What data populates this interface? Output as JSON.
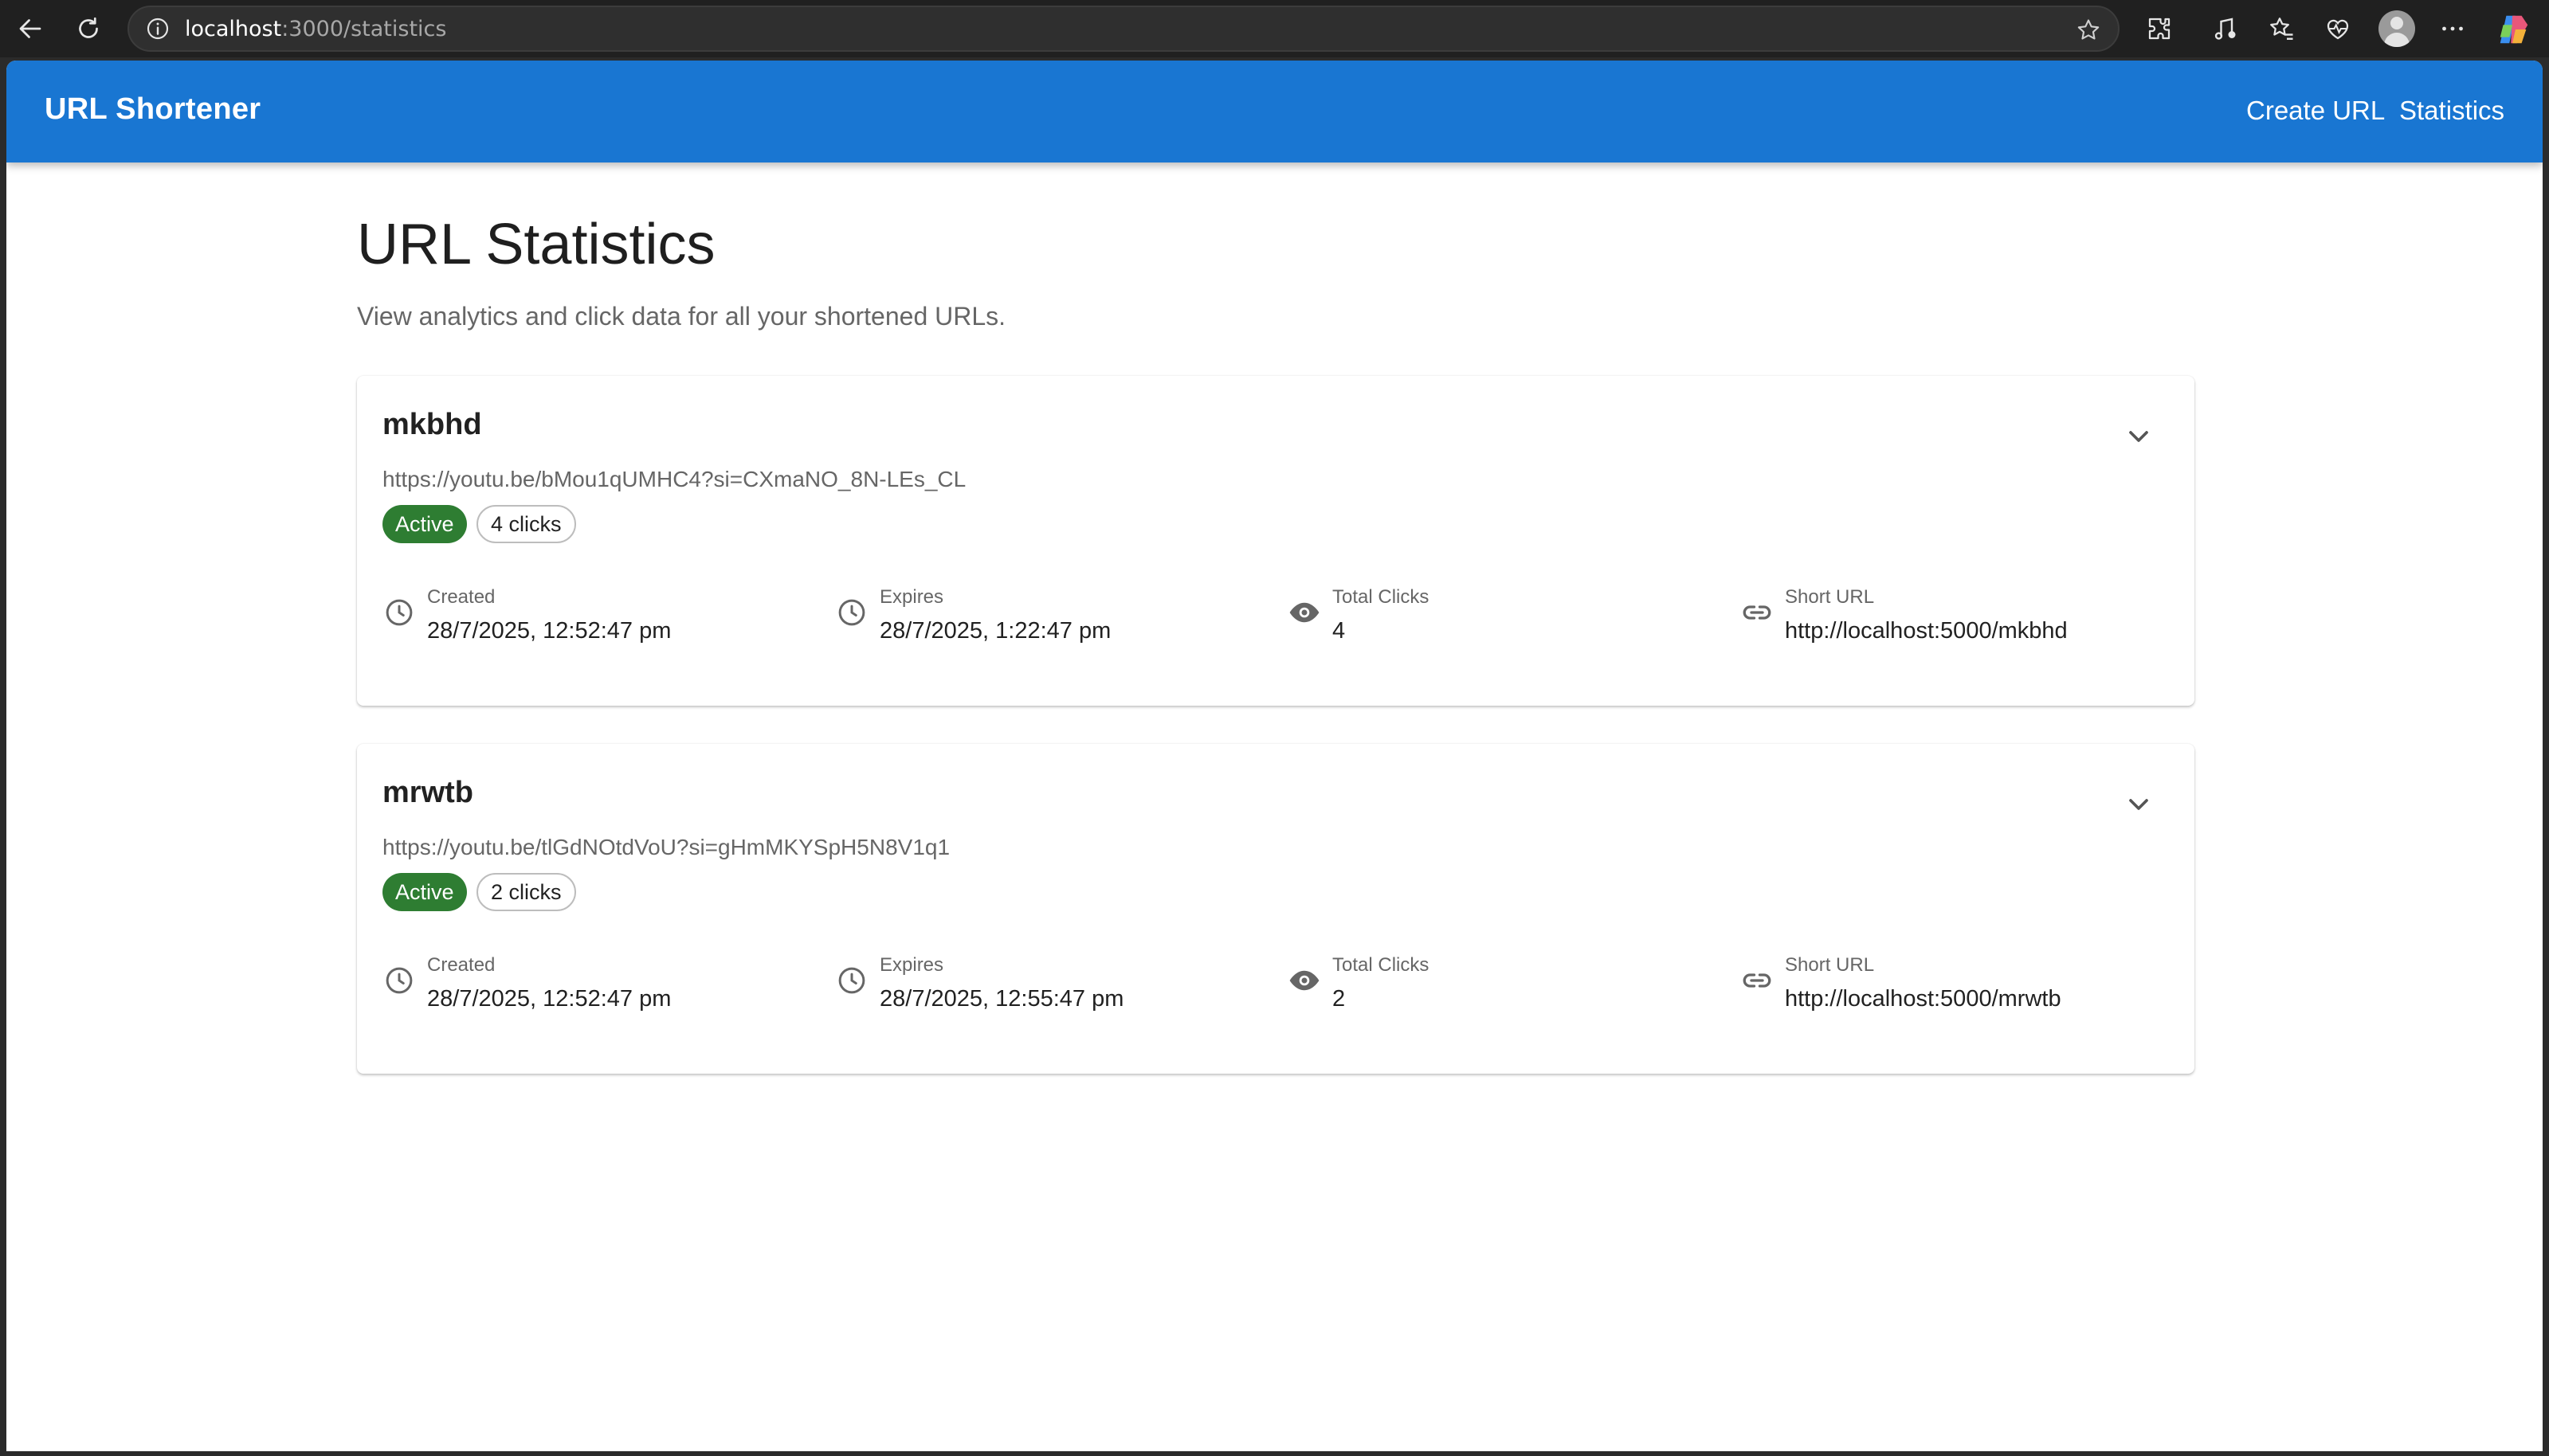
{
  "browser": {
    "address_host": "localhost",
    "address_path": ":3000/statistics"
  },
  "app": {
    "title": "URL Shortener",
    "nav": {
      "create_label": "Create URL",
      "statistics_label": "Statistics"
    }
  },
  "page": {
    "title": "URL Statistics",
    "subtitle": "View analytics and click data for all your shortened URLs."
  },
  "cards": [
    {
      "code": "mkbhd",
      "original_url": "https://youtu.be/bMou1qUMHC4?si=CXmaNO_8N-LEs_CL",
      "status": "Active",
      "clicks_chip": "4 clicks",
      "created_label": "Created",
      "created_value": "28/7/2025, 12:52:47 pm",
      "expires_label": "Expires",
      "expires_value": "28/7/2025, 1:22:47 pm",
      "total_label": "Total Clicks",
      "total_value": "4",
      "short_label": "Short URL",
      "short_value": "http://localhost:5000/mkbhd"
    },
    {
      "code": "mrwtb",
      "original_url": "https://youtu.be/tlGdNOtdVoU?si=gHmMKYSpH5N8V1q1",
      "status": "Active",
      "clicks_chip": "2 clicks",
      "created_label": "Created",
      "created_value": "28/7/2025, 12:52:47 pm",
      "expires_label": "Expires",
      "expires_value": "28/7/2025, 12:55:47 pm",
      "total_label": "Total Clicks",
      "total_value": "2",
      "short_label": "Short URL",
      "short_value": "http://localhost:5000/mrwtb"
    }
  ],
  "colors": {
    "appbar": "#1976d2",
    "active_chip": "#2e7d32"
  }
}
